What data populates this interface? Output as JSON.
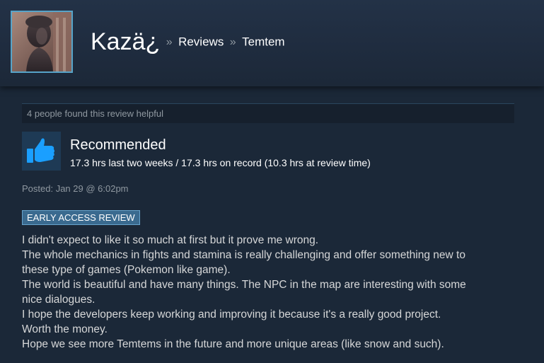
{
  "header": {
    "username": "Kazä¿",
    "separator": "»",
    "crumb_reviews": "Reviews",
    "crumb_game": "Temtem"
  },
  "review": {
    "helpful_text": "4 people found this review helpful",
    "verdict": "Recommended",
    "hours": "17.3 hrs last two weeks / 17.3 hrs on record (10.3 hrs at review time)",
    "posted": "Posted: Jan 29 @ 6:02pm",
    "badge": "EARLY ACCESS REVIEW",
    "body_lines": [
      "I didn't expect to like it so much at first but it prove me wrong.",
      "The whole mechanics in fights and stamina is really challenging and offer something new to",
      "these type of games (Pokemon like game).",
      "The world is beautiful and have many things. The NPC in the map are interesting with some",
      "nice dialogues.",
      "I hope the developers keep working and improving it because it's a really good project.",
      "Worth the money.",
      "Hope we see more Temtems in the future and more unique areas (like snow and such)."
    ]
  },
  "icons": {
    "avatar": "statue-avatar",
    "thumb": "thumbs-up-icon"
  },
  "colors": {
    "background": "#1b2838",
    "header": "#233247",
    "muted_text": "#8f98a0",
    "body_text": "#d6d7d8",
    "badge_bg": "#3a6a8f",
    "thumb_blue": "#1a9fff"
  }
}
